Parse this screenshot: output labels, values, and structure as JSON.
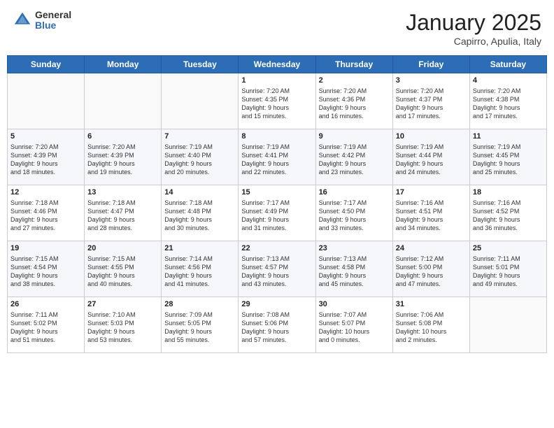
{
  "header": {
    "logo_general": "General",
    "logo_blue": "Blue",
    "month_year": "January 2025",
    "location": "Capirro, Apulia, Italy"
  },
  "weekdays": [
    "Sunday",
    "Monday",
    "Tuesday",
    "Wednesday",
    "Thursday",
    "Friday",
    "Saturday"
  ],
  "weeks": [
    [
      {
        "day": "",
        "info": ""
      },
      {
        "day": "",
        "info": ""
      },
      {
        "day": "",
        "info": ""
      },
      {
        "day": "1",
        "info": "Sunrise: 7:20 AM\nSunset: 4:35 PM\nDaylight: 9 hours\nand 15 minutes."
      },
      {
        "day": "2",
        "info": "Sunrise: 7:20 AM\nSunset: 4:36 PM\nDaylight: 9 hours\nand 16 minutes."
      },
      {
        "day": "3",
        "info": "Sunrise: 7:20 AM\nSunset: 4:37 PM\nDaylight: 9 hours\nand 17 minutes."
      },
      {
        "day": "4",
        "info": "Sunrise: 7:20 AM\nSunset: 4:38 PM\nDaylight: 9 hours\nand 17 minutes."
      }
    ],
    [
      {
        "day": "5",
        "info": "Sunrise: 7:20 AM\nSunset: 4:39 PM\nDaylight: 9 hours\nand 18 minutes."
      },
      {
        "day": "6",
        "info": "Sunrise: 7:20 AM\nSunset: 4:39 PM\nDaylight: 9 hours\nand 19 minutes."
      },
      {
        "day": "7",
        "info": "Sunrise: 7:19 AM\nSunset: 4:40 PM\nDaylight: 9 hours\nand 20 minutes."
      },
      {
        "day": "8",
        "info": "Sunrise: 7:19 AM\nSunset: 4:41 PM\nDaylight: 9 hours\nand 22 minutes."
      },
      {
        "day": "9",
        "info": "Sunrise: 7:19 AM\nSunset: 4:42 PM\nDaylight: 9 hours\nand 23 minutes."
      },
      {
        "day": "10",
        "info": "Sunrise: 7:19 AM\nSunset: 4:44 PM\nDaylight: 9 hours\nand 24 minutes."
      },
      {
        "day": "11",
        "info": "Sunrise: 7:19 AM\nSunset: 4:45 PM\nDaylight: 9 hours\nand 25 minutes."
      }
    ],
    [
      {
        "day": "12",
        "info": "Sunrise: 7:18 AM\nSunset: 4:46 PM\nDaylight: 9 hours\nand 27 minutes."
      },
      {
        "day": "13",
        "info": "Sunrise: 7:18 AM\nSunset: 4:47 PM\nDaylight: 9 hours\nand 28 minutes."
      },
      {
        "day": "14",
        "info": "Sunrise: 7:18 AM\nSunset: 4:48 PM\nDaylight: 9 hours\nand 30 minutes."
      },
      {
        "day": "15",
        "info": "Sunrise: 7:17 AM\nSunset: 4:49 PM\nDaylight: 9 hours\nand 31 minutes."
      },
      {
        "day": "16",
        "info": "Sunrise: 7:17 AM\nSunset: 4:50 PM\nDaylight: 9 hours\nand 33 minutes."
      },
      {
        "day": "17",
        "info": "Sunrise: 7:16 AM\nSunset: 4:51 PM\nDaylight: 9 hours\nand 34 minutes."
      },
      {
        "day": "18",
        "info": "Sunrise: 7:16 AM\nSunset: 4:52 PM\nDaylight: 9 hours\nand 36 minutes."
      }
    ],
    [
      {
        "day": "19",
        "info": "Sunrise: 7:15 AM\nSunset: 4:54 PM\nDaylight: 9 hours\nand 38 minutes."
      },
      {
        "day": "20",
        "info": "Sunrise: 7:15 AM\nSunset: 4:55 PM\nDaylight: 9 hours\nand 40 minutes."
      },
      {
        "day": "21",
        "info": "Sunrise: 7:14 AM\nSunset: 4:56 PM\nDaylight: 9 hours\nand 41 minutes."
      },
      {
        "day": "22",
        "info": "Sunrise: 7:13 AM\nSunset: 4:57 PM\nDaylight: 9 hours\nand 43 minutes."
      },
      {
        "day": "23",
        "info": "Sunrise: 7:13 AM\nSunset: 4:58 PM\nDaylight: 9 hours\nand 45 minutes."
      },
      {
        "day": "24",
        "info": "Sunrise: 7:12 AM\nSunset: 5:00 PM\nDaylight: 9 hours\nand 47 minutes."
      },
      {
        "day": "25",
        "info": "Sunrise: 7:11 AM\nSunset: 5:01 PM\nDaylight: 9 hours\nand 49 minutes."
      }
    ],
    [
      {
        "day": "26",
        "info": "Sunrise: 7:11 AM\nSunset: 5:02 PM\nDaylight: 9 hours\nand 51 minutes."
      },
      {
        "day": "27",
        "info": "Sunrise: 7:10 AM\nSunset: 5:03 PM\nDaylight: 9 hours\nand 53 minutes."
      },
      {
        "day": "28",
        "info": "Sunrise: 7:09 AM\nSunset: 5:05 PM\nDaylight: 9 hours\nand 55 minutes."
      },
      {
        "day": "29",
        "info": "Sunrise: 7:08 AM\nSunset: 5:06 PM\nDaylight: 9 hours\nand 57 minutes."
      },
      {
        "day": "30",
        "info": "Sunrise: 7:07 AM\nSunset: 5:07 PM\nDaylight: 10 hours\nand 0 minutes."
      },
      {
        "day": "31",
        "info": "Sunrise: 7:06 AM\nSunset: 5:08 PM\nDaylight: 10 hours\nand 2 minutes."
      },
      {
        "day": "",
        "info": ""
      }
    ]
  ]
}
